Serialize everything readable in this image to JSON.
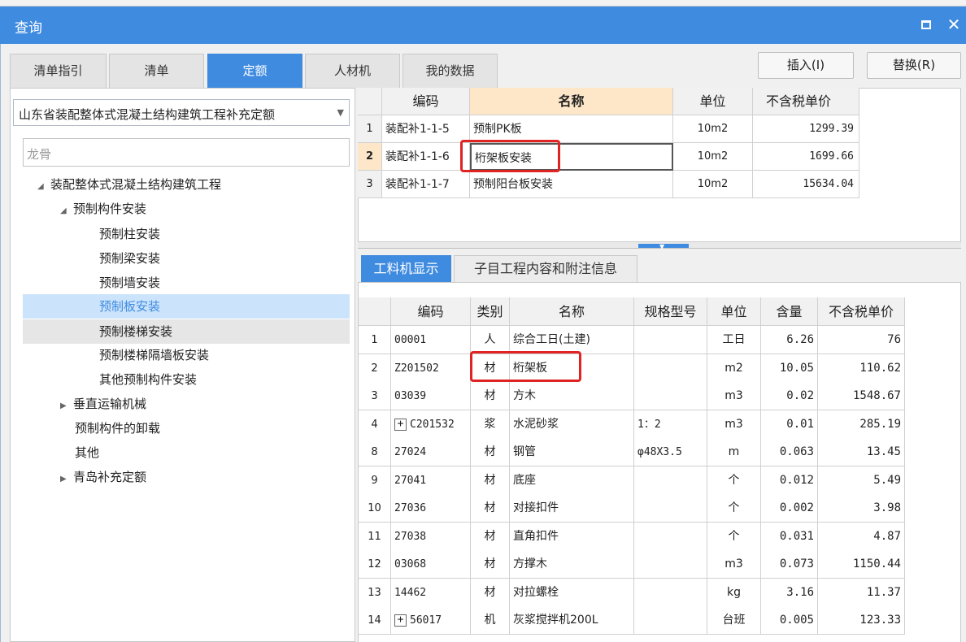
{
  "window": {
    "title": "查询"
  },
  "tabs": [
    "清单指引",
    "清单",
    "定额",
    "人材机",
    "我的数据"
  ],
  "actions": {
    "insert": "插入(I)",
    "replace": "替换(R)"
  },
  "library": {
    "selected": "山东省装配整体式混凝土结构建筑工程补充定额"
  },
  "search": {
    "placeholder": "龙骨"
  },
  "tree": [
    "装配整体式混凝土结构建筑工程",
    "预制构件安装",
    "预制柱安装",
    "预制梁安装",
    "预制墙安装",
    "预制板安装",
    "预制楼梯安装",
    "预制楼梯隔墙板安装",
    "其他预制构件安装",
    "垂直运输机械",
    "预制构件的卸载",
    "其他",
    "青岛补充定额"
  ],
  "quota_table": {
    "headers": [
      "编码",
      "名称",
      "单位",
      "不含税单价"
    ],
    "rows": [
      {
        "no": "1",
        "code": "装配补1-1-5",
        "name": "预制PK板",
        "unit": "10m2",
        "price": "1299.39"
      },
      {
        "no": "2",
        "code": "装配补1-1-6",
        "name": "桁架板安装",
        "unit": "10m2",
        "price": "1699.66"
      },
      {
        "no": "3",
        "code": "装配补1-1-7",
        "name": "预制阳台板安装",
        "unit": "10m2",
        "price": "15634.04"
      }
    ]
  },
  "subtabs": [
    "工料机显示",
    "子目工程内容和附注信息"
  ],
  "material_table": {
    "headers": [
      "编码",
      "类别",
      "名称",
      "规格型号",
      "单位",
      "含量",
      "不含税单价"
    ],
    "rows": [
      {
        "no": "1",
        "code": "00001",
        "type": "人",
        "name": "综合工日(土建)",
        "spec": "",
        "unit": "工日",
        "qty": "6.26",
        "price": "76"
      },
      {
        "no": "2",
        "code": "Z201502",
        "type": "材",
        "name": "桁架板",
        "spec": "",
        "unit": "m2",
        "qty": "10.05",
        "price": "110.62"
      },
      {
        "no": "3",
        "code": "03039",
        "type": "材",
        "name": "方木",
        "spec": "",
        "unit": "m3",
        "qty": "0.02",
        "price": "1548.67"
      },
      {
        "no": "4",
        "code": "C201532",
        "type": "浆",
        "name": "水泥砂浆",
        "spec": "1：2",
        "unit": "m3",
        "qty": "0.01",
        "price": "285.19"
      },
      {
        "no": "8",
        "code": "27024",
        "type": "材",
        "name": "钢管",
        "spec": "φ48X3.5",
        "unit": "m",
        "qty": "0.063",
        "price": "13.45"
      },
      {
        "no": "9",
        "code": "27041",
        "type": "材",
        "name": "底座",
        "spec": "",
        "unit": "个",
        "qty": "0.012",
        "price": "5.49"
      },
      {
        "no": "10",
        "code": "27036",
        "type": "材",
        "name": "对接扣件",
        "spec": "",
        "unit": "个",
        "qty": "0.002",
        "price": "3.98"
      },
      {
        "no": "11",
        "code": "27038",
        "type": "材",
        "name": "直角扣件",
        "spec": "",
        "unit": "个",
        "qty": "0.031",
        "price": "4.87"
      },
      {
        "no": "12",
        "code": "03068",
        "type": "材",
        "name": "方撑木",
        "spec": "",
        "unit": "m3",
        "qty": "0.073",
        "price": "1150.44"
      },
      {
        "no": "13",
        "code": "14462",
        "type": "材",
        "name": "对拉螺栓",
        "spec": "",
        "unit": "kg",
        "qty": "3.16",
        "price": "11.37"
      },
      {
        "no": "14",
        "code": "56017",
        "type": "机",
        "name": "灰浆搅拌机200L",
        "spec": "",
        "unit": "台班",
        "qty": "0.005",
        "price": "123.33"
      }
    ]
  },
  "colors": {
    "accent": "#3f8be0",
    "highlight": "#e02424",
    "selected_row": "#cce4fb"
  }
}
